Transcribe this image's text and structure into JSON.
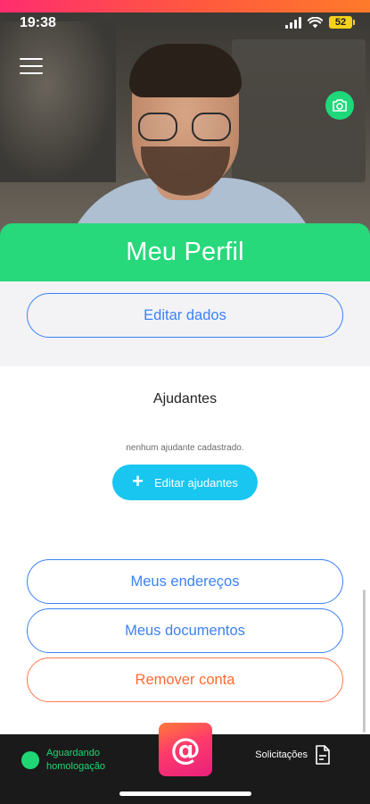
{
  "status_bar": {
    "time": "19:38",
    "battery": "52"
  },
  "header": {
    "title": "Meu Perfil"
  },
  "profile": {
    "edit_button": "Editar dados"
  },
  "helpers": {
    "title": "Ajudantes",
    "empty_message": "nenhum ajudante cadastrado.",
    "edit_button": "Editar ajudantes"
  },
  "actions": {
    "addresses": "Meus endereços",
    "documents": "Meus documentos",
    "remove_account": "Remover conta"
  },
  "bottom_bar": {
    "status_label_line1": "Aguardando",
    "status_label_line2": "homologação",
    "requests_label": "Solicitações"
  },
  "colors": {
    "accent_green": "#27d97b",
    "accent_blue": "#3b82f6",
    "helpers_button": "#18c6f0",
    "danger": "#ff6a36"
  },
  "icons": {
    "menu": "hamburger-menu-icon",
    "camera": "camera-icon",
    "plus": "plus-icon",
    "fab": "at-sign-icon",
    "requests": "document-icon"
  }
}
